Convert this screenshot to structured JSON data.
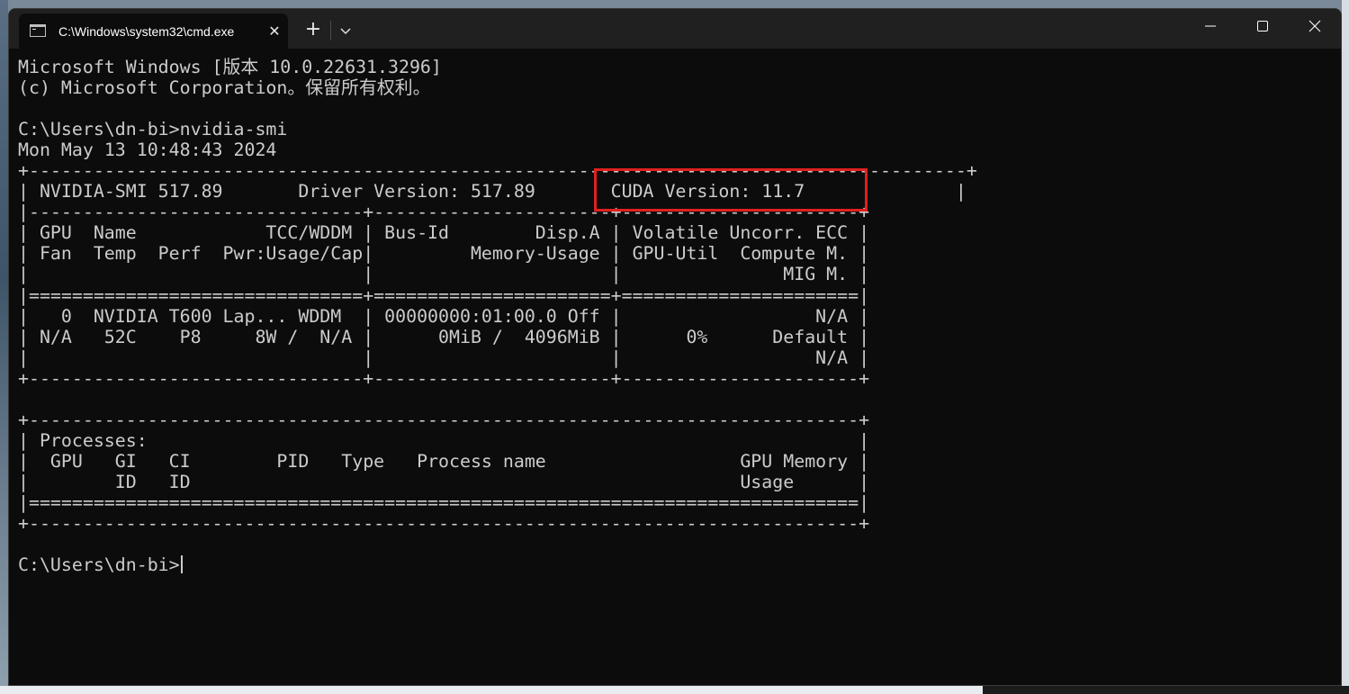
{
  "window": {
    "tab_title": "C:\\Windows\\system32\\cmd.exe",
    "tab_close_glyph": "✕",
    "new_tab_glyph": "+",
    "icons": {
      "tab": "console-icon",
      "dropdown": "chevron-down-icon",
      "minimize": "minimize-icon",
      "maximize": "maximize-icon",
      "close": "close-icon"
    }
  },
  "terminal": {
    "lines": [
      "Microsoft Windows [版本 10.0.22631.3296]",
      "(c) Microsoft Corporation。保留所有权利。",
      "",
      "C:\\Users\\dn-bi>nvidia-smi",
      "Mon May 13 10:48:43 2024",
      "+---------------------------------------------------------------------------------------+",
      "| NVIDIA-SMI 517.89       Driver Version: 517.89       CUDA Version: 11.7              |",
      "|-------------------------------+----------------------+----------------------+",
      "| GPU  Name            TCC/WDDM | Bus-Id        Disp.A | Volatile Uncorr. ECC |",
      "| Fan  Temp  Perf  Pwr:Usage/Cap|         Memory-Usage | GPU-Util  Compute M. |",
      "|                               |                      |               MIG M. |",
      "|===============================+======================+======================|",
      "|   0  NVIDIA T600 Lap... WDDM  | 00000000:01:00.0 Off |                  N/A |",
      "| N/A   52C    P8     8W /  N/A |      0MiB /  4096MiB |      0%      Default |",
      "|                               |                      |                  N/A |",
      "+-------------------------------+----------------------+----------------------+",
      "",
      "+-----------------------------------------------------------------------------+",
      "| Processes:                                                                  |",
      "|  GPU   GI   CI        PID   Type   Process name                  GPU Memory |",
      "|        ID   ID                                                   Usage      |",
      "|=============================================================================|",
      "+-----------------------------------------------------------------------------+",
      "",
      "C:\\Users\\dn-bi>"
    ]
  },
  "colors": {
    "terminal_bg": "#0c0c0c",
    "terminal_fg": "#cccccc",
    "titlebar_bg": "#202020",
    "highlight_border": "#e0201e"
  }
}
